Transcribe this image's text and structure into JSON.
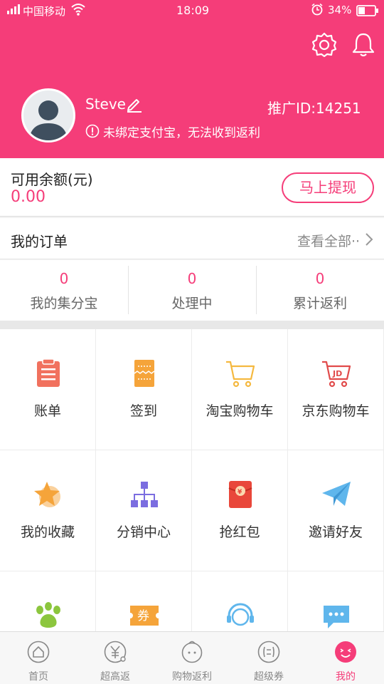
{
  "status_bar": {
    "carrier": "中国移动",
    "time": "18:09",
    "battery": "34%"
  },
  "profile": {
    "username": "Steve",
    "promo_id": "推广ID:14251",
    "warning": "未绑定支付宝，无法收到返利"
  },
  "balance": {
    "label": "可用余额(元)",
    "value": "0.00",
    "withdraw_label": "马上提现"
  },
  "orders": {
    "title": "我的订单",
    "view_all": "查看全部··",
    "stats": [
      {
        "value": "0",
        "label": "我的集分宝"
      },
      {
        "value": "0",
        "label": "处理中"
      },
      {
        "value": "0",
        "label": "累计返利"
      }
    ]
  },
  "grid": [
    {
      "label": "账单",
      "icon": "clipboard-icon"
    },
    {
      "label": "签到",
      "icon": "ticket-icon"
    },
    {
      "label": "淘宝购物车",
      "icon": "cart-icon"
    },
    {
      "label": "京东购物车",
      "icon": "jd-cart-icon"
    },
    {
      "label": "我的收藏",
      "icon": "star-icon"
    },
    {
      "label": "分销中心",
      "icon": "hierarchy-icon"
    },
    {
      "label": "抢红包",
      "icon": "red-envelope-icon"
    },
    {
      "label": "邀请好友",
      "icon": "paper-plane-icon"
    },
    {
      "label": "",
      "icon": "paw-icon"
    },
    {
      "label": "",
      "icon": "coupon-icon",
      "badge": "券"
    },
    {
      "label": "",
      "icon": "headset-icon"
    },
    {
      "label": "",
      "icon": "chat-icon"
    }
  ],
  "tabs": [
    {
      "label": "首页",
      "icon": "home-icon",
      "active": false
    },
    {
      "label": "超高返",
      "icon": "yen-icon",
      "active": false
    },
    {
      "label": "购物返利",
      "icon": "bag-icon",
      "active": false
    },
    {
      "label": "超级券",
      "icon": "coupon-tab-icon",
      "active": false
    },
    {
      "label": "我的",
      "icon": "smile-icon",
      "active": true
    }
  ],
  "colors": {
    "brand": "#f53d79",
    "background": "#f2f2f2"
  }
}
